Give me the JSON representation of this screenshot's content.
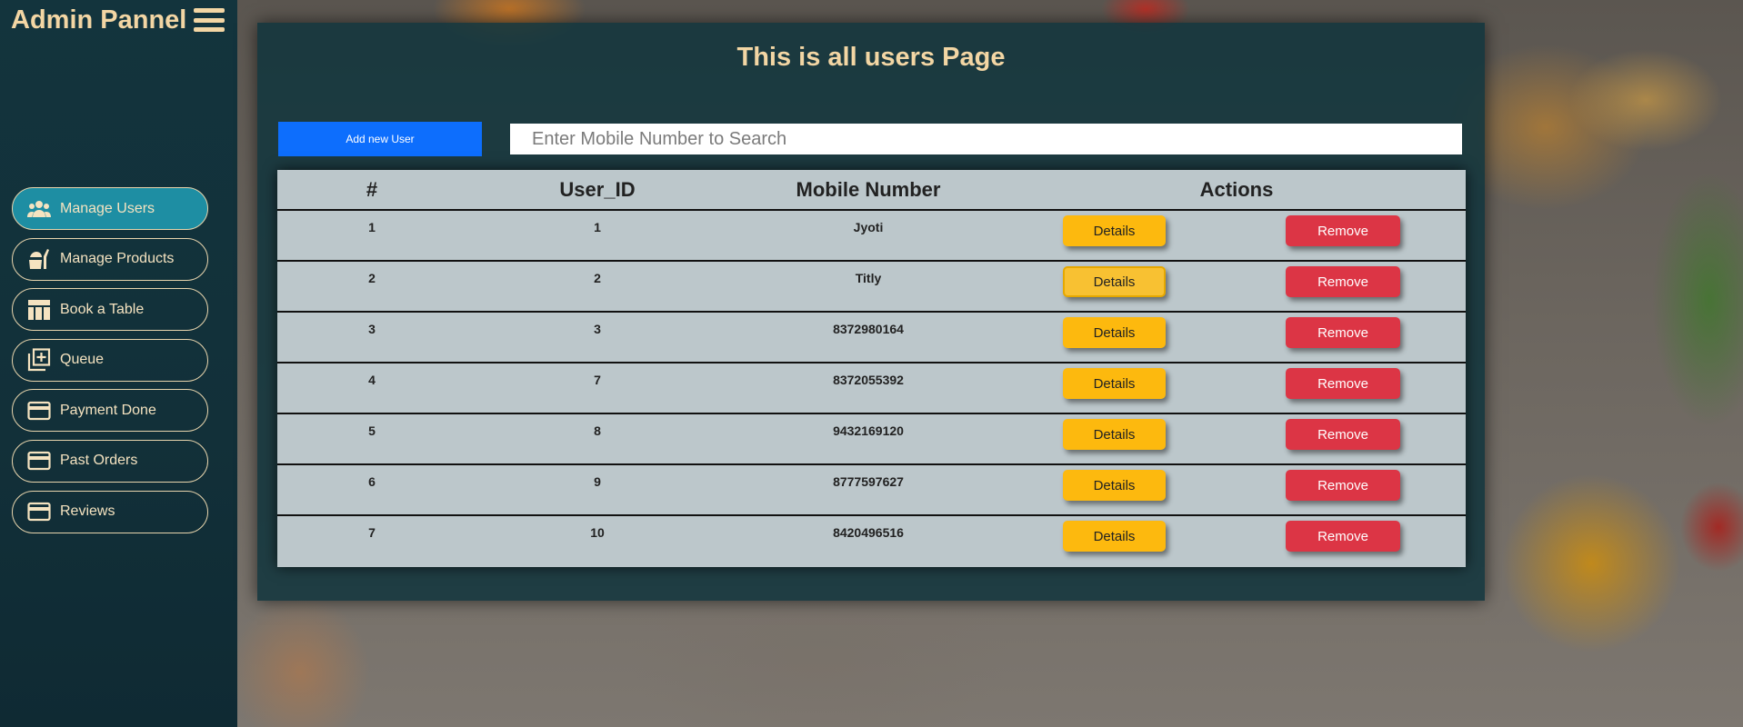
{
  "sidebar": {
    "brand": "Admin Pannel",
    "items": [
      {
        "label": "Manage Users",
        "icon": "users-icon",
        "active": true
      },
      {
        "label": "Manage Products",
        "icon": "food-icon",
        "active": false
      },
      {
        "label": "Book a Table",
        "icon": "table-icon",
        "active": false
      },
      {
        "label": "Queue",
        "icon": "queue-add-icon",
        "active": false
      },
      {
        "label": "Payment Done",
        "icon": "card-icon",
        "active": false
      },
      {
        "label": "Past Orders",
        "icon": "card-icon",
        "active": false
      },
      {
        "label": "Reviews",
        "icon": "card-icon",
        "active": false
      }
    ]
  },
  "main": {
    "title": "This is all users Page",
    "add_button": "Add new User",
    "search_placeholder": "Enter Mobile Number to Search",
    "columns": [
      "#",
      "User_ID",
      "Mobile Number",
      "Actions"
    ],
    "details_label": "Details",
    "remove_label": "Remove",
    "rows": [
      {
        "index": "1",
        "user_id": "1",
        "mobile": "Jyoti"
      },
      {
        "index": "2",
        "user_id": "2",
        "mobile": "Titly"
      },
      {
        "index": "3",
        "user_id": "3",
        "mobile": "8372980164"
      },
      {
        "index": "4",
        "user_id": "7",
        "mobile": "8372055392"
      },
      {
        "index": "5",
        "user_id": "8",
        "mobile": "9432169120"
      },
      {
        "index": "6",
        "user_id": "9",
        "mobile": "8777597627"
      },
      {
        "index": "7",
        "user_id": "10",
        "mobile": "8420496516"
      }
    ]
  },
  "colors": {
    "accent": "#f3d6a4",
    "active_nav": "#1e8ea3",
    "primary": "#0d6efd",
    "warning": "#fdb90e",
    "danger": "#dc3545"
  }
}
